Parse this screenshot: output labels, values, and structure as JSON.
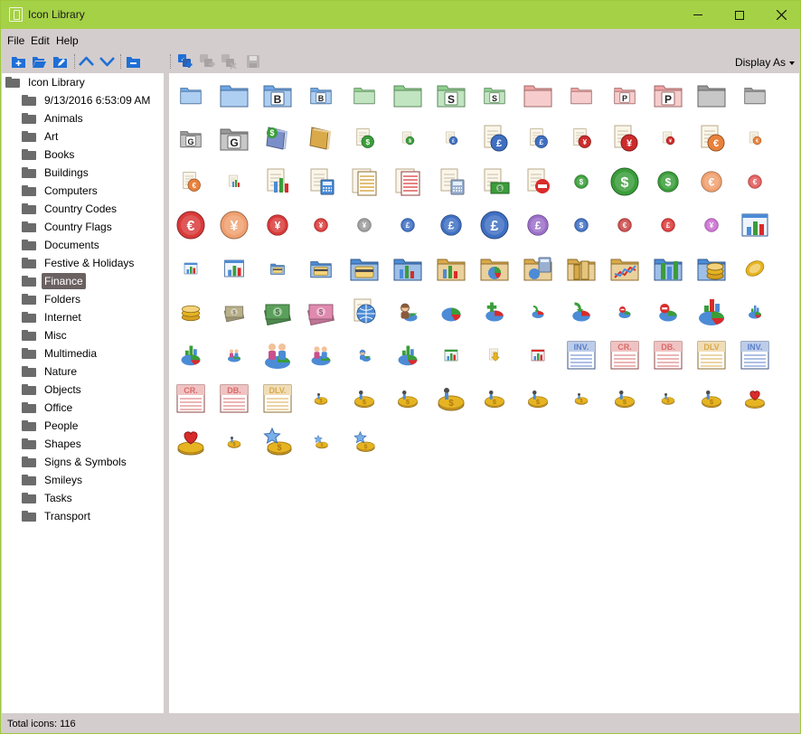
{
  "window": {
    "title": "Icon Library"
  },
  "menu": [
    "File",
    "Edit",
    "Help"
  ],
  "toolbar": {
    "display_as": "Display As",
    "buttons": [
      {
        "name": "new-item-icon",
        "color": "#1f6fd6"
      },
      {
        "name": "open-folder-icon",
        "color": "#1f6fd6"
      },
      {
        "name": "edit-folder-icon",
        "color": "#1f6fd6"
      },
      {
        "name": "move-up-icon",
        "color": "#1f6fd6"
      },
      {
        "name": "move-down-icon",
        "color": "#1f6fd6"
      },
      {
        "name": "remove-folder-icon",
        "color": "#1f6fd6"
      },
      {
        "name": "add-icon-icon",
        "color": "#1f6fd6"
      },
      {
        "name": "move-icon-icon",
        "color": "#b8b3b3"
      },
      {
        "name": "delete-icon-icon",
        "color": "#b8b3b3"
      },
      {
        "name": "save-icon",
        "color": "#b8b3b3"
      }
    ]
  },
  "tree": {
    "root": "Icon Library",
    "selected": "Finance",
    "items": [
      "9/13/2016 6:53:09 AM",
      "Animals",
      "Art",
      "Books",
      "Buildings",
      "Computers",
      "Country Codes",
      "Country Flags",
      "Documents",
      "Festive & Holidays",
      "Finance",
      "Folders",
      "Internet",
      "Misc",
      "Multimedia",
      "Nature",
      "Objects",
      "Office",
      "People",
      "Shapes",
      "Signs & Symbols",
      "Smileys",
      "Tasks",
      "Transport"
    ]
  },
  "status": {
    "total_icons": "Total icons: 116"
  },
  "icon_rows": [
    [
      {
        "k": "folder",
        "s": "m",
        "c": "#6ea8e8"
      },
      {
        "k": "folder",
        "s": "l",
        "c": "#6ea8e8"
      },
      {
        "k": "folder",
        "s": "l",
        "c": "#6ea8e8",
        "t": "B"
      },
      {
        "k": "folder",
        "s": "m",
        "c": "#6ea8e8",
        "t": "B"
      },
      {
        "k": "folder",
        "s": "m",
        "c": "#8fd08f"
      },
      {
        "k": "folder",
        "s": "l",
        "c": "#8fd08f"
      },
      {
        "k": "folder",
        "s": "l",
        "c": "#8fd08f",
        "t": "S"
      },
      {
        "k": "folder",
        "s": "m",
        "c": "#8fd08f",
        "t": "S"
      },
      {
        "k": "folder",
        "s": "l",
        "c": "#f0a3a3"
      },
      {
        "k": "folder",
        "s": "m",
        "c": "#f0a3a3"
      },
      {
        "k": "folder",
        "s": "m",
        "c": "#f0a3a3",
        "t": "P"
      },
      {
        "k": "folder",
        "s": "l",
        "c": "#f0a3a3",
        "t": "P"
      },
      {
        "k": "folder",
        "s": "l",
        "c": "#9a9a9a"
      },
      {
        "k": "folder",
        "s": "m",
        "c": "#9a9a9a"
      }
    ],
    [
      {
        "k": "folder",
        "s": "m",
        "c": "#9a9a9a",
        "t": "G"
      },
      {
        "k": "folder",
        "s": "l",
        "c": "#9a9a9a",
        "t": "G"
      },
      {
        "k": "wallet",
        "s": "l",
        "c": "#7a8fc9"
      },
      {
        "k": "wallet",
        "s": "l",
        "c": "#d9a94a"
      },
      {
        "k": "ledger",
        "s": "m",
        "c": "#3a9d3a",
        "t": "$"
      },
      {
        "k": "ledger",
        "s": "s",
        "c": "#3a9d3a",
        "t": "$"
      },
      {
        "k": "ledger",
        "s": "s",
        "c": "#3f6fc2",
        "t": "£"
      },
      {
        "k": "ledger",
        "s": "l",
        "c": "#3f6fc2",
        "t": "£"
      },
      {
        "k": "ledger",
        "s": "m",
        "c": "#3f6fc2",
        "t": "£"
      },
      {
        "k": "ledger",
        "s": "m",
        "c": "#cc2b2b",
        "t": "¥"
      },
      {
        "k": "ledger",
        "s": "l",
        "c": "#cc2b2b",
        "t": "¥"
      },
      {
        "k": "ledger",
        "s": "s",
        "c": "#cc2b2b",
        "t": "¥"
      },
      {
        "k": "ledger",
        "s": "l",
        "c": "#e8823c",
        "t": "€"
      },
      {
        "k": "ledger",
        "s": "s",
        "c": "#e8823c",
        "t": "€"
      }
    ],
    [
      {
        "k": "ledger",
        "s": "m",
        "c": "#e8823c",
        "t": "€"
      },
      {
        "k": "chartdoc",
        "s": "s",
        "c": "#4c8bd6"
      },
      {
        "k": "chartdoc",
        "s": "l",
        "c": "#4c8bd6"
      },
      {
        "k": "calcdoc",
        "s": "l",
        "c": "#4c8bd6"
      },
      {
        "k": "ledgerdoc",
        "s": "l",
        "c": "#d9a94a"
      },
      {
        "k": "ledgerdoc",
        "s": "l",
        "c": "#e05a5a"
      },
      {
        "k": "calcdoc",
        "s": "l",
        "c": "#9ab0d0"
      },
      {
        "k": "billdoc",
        "s": "l",
        "c": "#3a9d3a"
      },
      {
        "k": "stopdoc",
        "s": "l",
        "c": "#d92b2b"
      },
      {
        "k": "coin",
        "s": "s",
        "c": "#3a9d3a",
        "t": "$"
      },
      {
        "k": "coin",
        "s": "l",
        "c": "#3a9d3a",
        "t": "$"
      },
      {
        "k": "coin",
        "s": "m",
        "c": "#3a9d3a",
        "t": "$"
      },
      {
        "k": "coin",
        "s": "m",
        "c": "#f0a070",
        "t": "€"
      },
      {
        "k": "coin",
        "s": "s",
        "c": "#e05a5a",
        "t": "€"
      }
    ],
    [
      {
        "k": "coin",
        "s": "l",
        "c": "#d93a3a",
        "t": "€"
      },
      {
        "k": "coin",
        "s": "l",
        "c": "#f0a070",
        "t": "¥"
      },
      {
        "k": "coin",
        "s": "m",
        "c": "#d93a3a",
        "t": "¥"
      },
      {
        "k": "coin",
        "s": "s",
        "c": "#d93a3a",
        "t": "¥"
      },
      {
        "k": "coin",
        "s": "s",
        "c": "#9a9a9a",
        "t": "¥"
      },
      {
        "k": "coin",
        "s": "s",
        "c": "#3f6fc2",
        "t": "£"
      },
      {
        "k": "coin",
        "s": "m",
        "c": "#3f6fc2",
        "t": "£"
      },
      {
        "k": "coin",
        "s": "l",
        "c": "#3f6fc2",
        "t": "£"
      },
      {
        "k": "coin",
        "s": "m",
        "c": "#9b6fc9",
        "t": "£"
      },
      {
        "k": "coin",
        "s": "s",
        "c": "#3f6fc2",
        "t": "$"
      },
      {
        "k": "coin",
        "s": "s",
        "c": "#c94a4a",
        "t": "€"
      },
      {
        "k": "coin",
        "s": "s",
        "c": "#d93a3a",
        "t": "£"
      },
      {
        "k": "coin",
        "s": "s",
        "c": "#c96fd0",
        "t": "¥"
      },
      {
        "k": "barchart",
        "s": "l",
        "c": "#4c8bd6"
      }
    ],
    [
      {
        "k": "barchart",
        "s": "s",
        "c": "#4c8bd6"
      },
      {
        "k": "barchart",
        "s": "m",
        "c": "#4c8bd6"
      },
      {
        "k": "cardfolder",
        "s": "s",
        "c": "#4c8bd6"
      },
      {
        "k": "cardfolder",
        "s": "m",
        "c": "#4c8bd6"
      },
      {
        "k": "cardfolder",
        "s": "l",
        "c": "#4c8bd6"
      },
      {
        "k": "chartfolder",
        "s": "l",
        "c": "#4c8bd6"
      },
      {
        "k": "chartfolder",
        "s": "l",
        "c": "#d9a94a"
      },
      {
        "k": "piefolder",
        "s": "l",
        "c": "#d9a94a"
      },
      {
        "k": "calcfolder",
        "s": "l",
        "c": "#d9a94a"
      },
      {
        "k": "buildfolder",
        "s": "l",
        "c": "#d9a94a"
      },
      {
        "k": "linefolder",
        "s": "l",
        "c": "#d9a94a"
      },
      {
        "k": "barfolder",
        "s": "l",
        "c": "#4c8bd6"
      },
      {
        "k": "coinfolder",
        "s": "l",
        "c": "#4c8bd6"
      },
      {
        "k": "gold",
        "s": "m",
        "c": "#e6b422"
      }
    ],
    [
      {
        "k": "goldstack",
        "s": "m",
        "c": "#e6b422"
      },
      {
        "k": "cash",
        "s": "m",
        "c": "#b8b08a"
      },
      {
        "k": "cash",
        "s": "l",
        "c": "#5aa05a"
      },
      {
        "k": "cash",
        "s": "l",
        "c": "#e08ab0"
      },
      {
        "k": "globe",
        "s": "l",
        "c": "#4c8bd6"
      },
      {
        "k": "person",
        "s": "m",
        "c": "#8a5a3a"
      },
      {
        "k": "pie",
        "s": "m",
        "c": "#4c8bd6"
      },
      {
        "k": "pieplus",
        "s": "m",
        "c": "#3a9d3a"
      },
      {
        "k": "piearrow",
        "s": "s",
        "c": "#3a9d3a"
      },
      {
        "k": "piearrow",
        "s": "m",
        "c": "#3a9d3a"
      },
      {
        "k": "pieminus",
        "s": "s",
        "c": "#d92b2b"
      },
      {
        "k": "pieminus",
        "s": "m",
        "c": "#d92b2b"
      },
      {
        "k": "piebar",
        "s": "l",
        "c": "#d92b2b"
      },
      {
        "k": "piebar",
        "s": "s",
        "c": "#4c8bd6"
      }
    ],
    [
      {
        "k": "piebar",
        "s": "m",
        "c": "#3a9d3a"
      },
      {
        "k": "people",
        "s": "s",
        "c": "#c9508a"
      },
      {
        "k": "people",
        "s": "l",
        "c": "#c9508a"
      },
      {
        "k": "people",
        "s": "m",
        "c": "#c9508a"
      },
      {
        "k": "person",
        "s": "s",
        "c": "#4c8bd6"
      },
      {
        "k": "piebar",
        "s": "m",
        "c": "#3a9d3a"
      },
      {
        "k": "barchart",
        "s": "s",
        "c": "#3a9d3a"
      },
      {
        "k": "arrowdoc",
        "s": "s",
        "c": "#e6b422"
      },
      {
        "k": "barchart",
        "s": "s",
        "c": "#d92b2b"
      },
      {
        "k": "inv",
        "s": "l",
        "c": "#5a7fc9",
        "t": "INV."
      },
      {
        "k": "inv",
        "s": "l",
        "c": "#d96a6a",
        "t": "CR."
      },
      {
        "k": "inv",
        "s": "l",
        "c": "#d96a6a",
        "t": "DB."
      },
      {
        "k": "inv",
        "s": "l",
        "c": "#d9a94a",
        "t": "DLV"
      },
      {
        "k": "inv",
        "s": "l",
        "c": "#5a7fc9",
        "t": "INV."
      }
    ],
    [
      {
        "k": "inv",
        "s": "l",
        "c": "#d96a6a",
        "t": "CR."
      },
      {
        "k": "inv",
        "s": "l",
        "c": "#d96a6a",
        "t": "DB."
      },
      {
        "k": "inv",
        "s": "l",
        "c": "#d9a94a",
        "t": "DLV."
      },
      {
        "k": "goldcoin",
        "s": "s",
        "c": "#e6b422"
      },
      {
        "k": "goldcoin",
        "s": "m",
        "c": "#e6b422"
      },
      {
        "k": "goldcoin",
        "s": "m",
        "c": "#e6b422"
      },
      {
        "k": "goldcoin",
        "s": "l",
        "c": "#e6b422"
      },
      {
        "k": "goldcoin",
        "s": "m",
        "c": "#e6b422"
      },
      {
        "k": "goldcoin",
        "s": "m",
        "c": "#e6b422"
      },
      {
        "k": "goldcoin",
        "s": "s",
        "c": "#e6b422"
      },
      {
        "k": "goldcoin",
        "s": "m",
        "c": "#e6b422"
      },
      {
        "k": "goldcoin",
        "s": "s",
        "c": "#e6b422"
      },
      {
        "k": "goldcoin",
        "s": "m",
        "c": "#e6b422"
      },
      {
        "k": "heartcoin",
        "s": "m",
        "c": "#d92b2b"
      }
    ],
    [
      {
        "k": "heartcoin",
        "s": "l",
        "c": "#d92b2b"
      },
      {
        "k": "goldcoin",
        "s": "s",
        "c": "#e6b422"
      },
      {
        "k": "starcoin",
        "s": "l",
        "c": "#e6b422"
      },
      {
        "k": "starcoin",
        "s": "s",
        "c": "#e6b422"
      },
      {
        "k": "starcoin",
        "s": "m",
        "c": "#e6b422"
      }
    ]
  ]
}
